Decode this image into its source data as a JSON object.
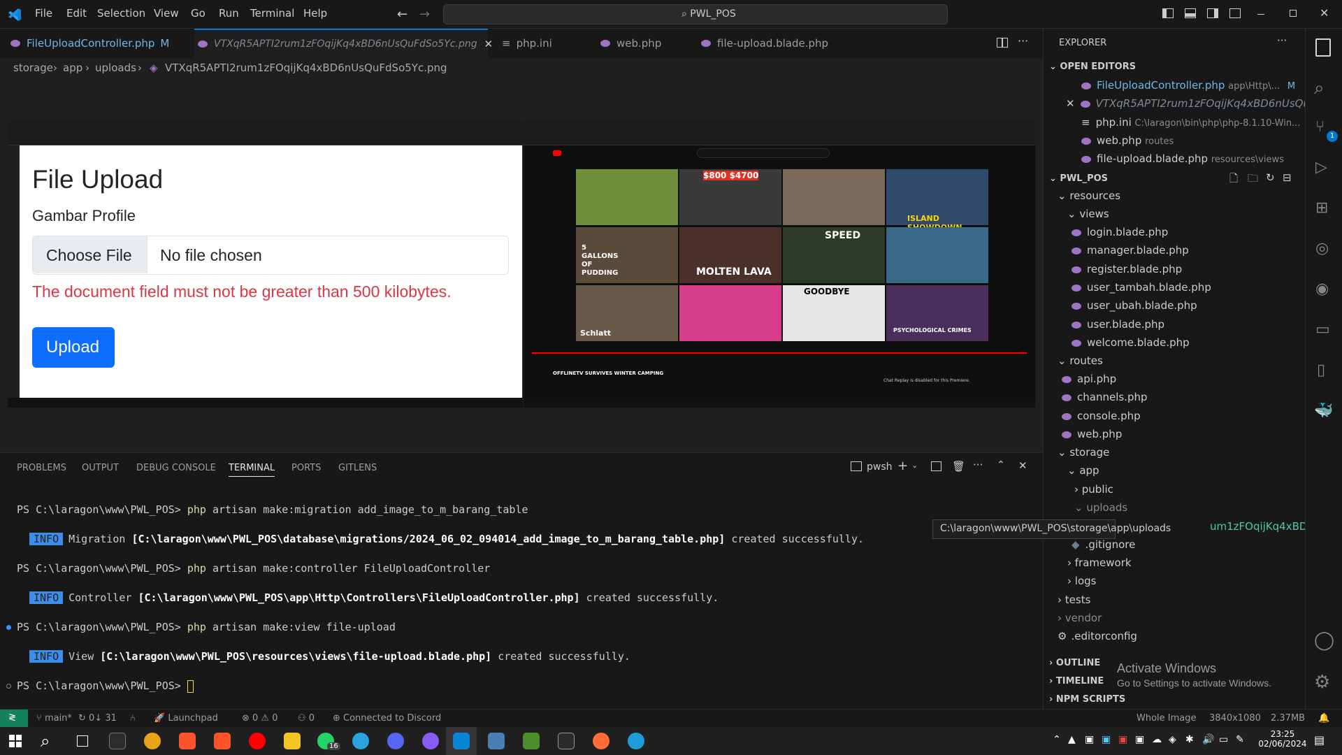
{
  "menu": [
    "File",
    "Edit",
    "Selection",
    "View",
    "Go",
    "Run",
    "Terminal",
    "Help"
  ],
  "search_title": "PWL_POS",
  "tabs": [
    {
      "label": "FileUploadController.php",
      "badge": "M"
    },
    {
      "label": "VTXqR5APTI2rum1zFOqijKq4xBD6nUsQuFdSo5Yc.png"
    },
    {
      "label": "php.ini"
    },
    {
      "label": "web.php"
    },
    {
      "label": "file-upload.blade.php"
    }
  ],
  "breadcrumb": [
    "storage",
    "app",
    "uploads",
    "VTXqR5APTI2rum1zFOqijKq4xBD6nUsQuFdSo5Yc.png"
  ],
  "preview": {
    "title": "File Upload",
    "field_label": "Gambar Profile",
    "choose_file": "Choose File",
    "no_file": "No file chosen",
    "error": "The document field must not be greater than 500 kilobytes.",
    "upload_button": "Upload",
    "yt_title": "OFFLINETV SURVIVES WINTER CAMPING",
    "yt_chat": "Chat Replay is disabled for this Premiere.",
    "thumbs": [
      "$800 $4700",
      "ISLAND SHOWDOWN",
      "5 GALLONS OF PUDDING",
      "MOLTEN LAVA",
      "SPEED",
      "Schlatt",
      "GOODBYE",
      "PSYCHOLOGICAL CRIMES"
    ]
  },
  "panel": {
    "tabs": [
      "PROBLEMS",
      "OUTPUT",
      "DEBUG CONSOLE",
      "TERMINAL",
      "PORTS",
      "GITLENS"
    ],
    "shell": "pwsh"
  },
  "terminal": [
    {
      "prompt": "PS C:\\laragon\\www\\PWL_POS> ",
      "cmd": "php",
      "rest": " artisan make:migration add_image_to_m_barang_table"
    },
    {
      "info": "INFO",
      "pre": "Migration ",
      "path": "[C:\\laragon\\www\\PWL_POS\\database\\migrations/2024_06_02_094014_add_image_to_m_barang_table.php]",
      "post": " created successfully."
    },
    {
      "prompt": "PS C:\\laragon\\www\\PWL_POS> ",
      "cmd": "php",
      "rest": " artisan make:controller FileUploadController"
    },
    {
      "info": "INFO",
      "pre": "Controller ",
      "path": "[C:\\laragon\\www\\PWL_POS\\app\\Http\\Controllers\\FileUploadController.php]",
      "post": " created successfully."
    },
    {
      "prompt": "PS C:\\laragon\\www\\PWL_POS> ",
      "cmd": "php",
      "rest": " artisan make:view file-upload"
    },
    {
      "info": "INFO",
      "pre": "View ",
      "path": "[C:\\laragon\\www\\PWL_POS\\resources\\views\\file-upload.blade.php]",
      "post": " created successfully."
    },
    {
      "prompt": "PS C:\\laragon\\www\\PWL_POS> ",
      "cmd": "",
      "rest": ""
    }
  ],
  "explorer": {
    "header": "EXPLORER",
    "open_editors": "OPEN EDITORS",
    "open_files": [
      {
        "name": "FileUploadController.php",
        "hint": "app\\Http\\...",
        "badge": "M"
      },
      {
        "name": "VTXqR5APTI2rum1zFOqijKq4xBD6nUsQu...",
        "hint": ""
      },
      {
        "name": "php.ini",
        "hint": "C:\\laragon\\bin\\php\\php-8.1.10-Win..."
      },
      {
        "name": "web.php",
        "hint": "routes"
      },
      {
        "name": "file-upload.blade.php",
        "hint": "resources\\views"
      }
    ],
    "project": "PWL_POS",
    "tree": {
      "resources": "resources",
      "views": "views",
      "view_files": [
        "login.blade.php",
        "manager.blade.php",
        "register.blade.php",
        "user_tambah.blade.php",
        "user_ubah.blade.php",
        "user.blade.php",
        "welcome.blade.php"
      ],
      "routes": "routes",
      "route_files": [
        "api.php",
        "channels.php",
        "console.php",
        "web.php"
      ],
      "storage": "storage",
      "app": "app",
      "public": "public",
      "uploads": "uploads",
      "uploaded_file": "um1zFOqijKq4xBD6nUsQu...",
      "gitignore": ".gitignore",
      "framework": "framework",
      "logs": "logs",
      "tests": "tests",
      "vendor": "vendor",
      "editorconfig": ".editorconfig"
    },
    "outline": "OUTLINE",
    "timeline": "TIMELINE",
    "npm": "NPM SCRIPTS",
    "tooltip": "C:\\laragon\\www\\PWL_POS\\storage\\app\\uploads"
  },
  "watermark": {
    "line1": "Activate Windows",
    "line2": "Go to Settings to activate Windows."
  },
  "status": {
    "branch": "main*",
    "sync": "0↓ 31",
    "launchpad": "Launchpad",
    "problems": "0 ⚠ 0",
    "ports": "0",
    "discord": "Connected to Discord",
    "image_type": "Whole Image",
    "dimensions": "3840x1080",
    "size": "2.37MB"
  },
  "taskbar": {
    "time": "23:25",
    "date": "02/06/2024",
    "whatsapp_badge": "16"
  },
  "colors": {
    "accent": "#0078d4",
    "error": "#dc3545",
    "upload_btn": "#0d6efd",
    "info": "#3b8eea"
  }
}
